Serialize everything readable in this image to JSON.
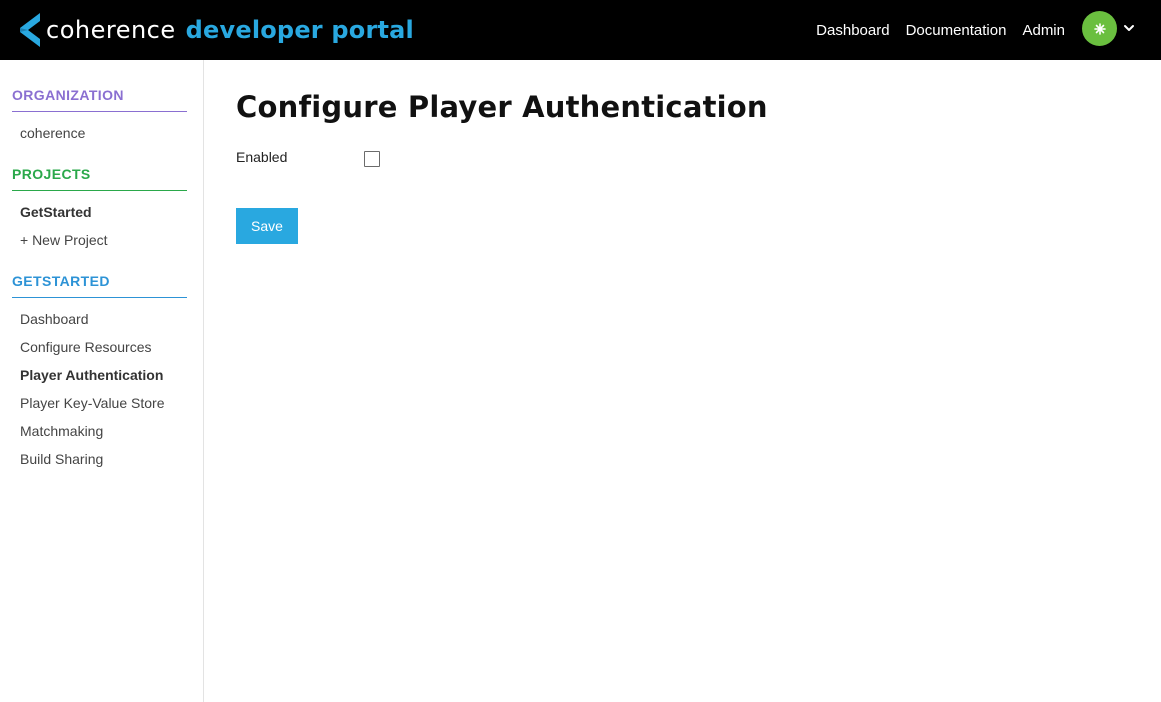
{
  "header": {
    "brand_name": "coherence",
    "brand_sub": "developer portal",
    "nav": [
      {
        "label": "Dashboard"
      },
      {
        "label": "Documentation"
      },
      {
        "label": "Admin"
      }
    ],
    "avatar_color": "#6abf3f",
    "accent": "#29a8e0"
  },
  "sidebar": {
    "organization": {
      "heading": "ORGANIZATION",
      "color": "#8a6fd1",
      "items": [
        {
          "label": "coherence"
        }
      ]
    },
    "projects": {
      "heading": "PROJECTS",
      "color": "#2aa84a",
      "items": [
        {
          "label": "GetStarted",
          "active": true
        },
        {
          "label": "+ New Project"
        }
      ]
    },
    "project_nav": {
      "heading": "GETSTARTED",
      "color": "#2d93d6",
      "items": [
        {
          "label": "Dashboard"
        },
        {
          "label": "Configure Resources"
        },
        {
          "label": "Player Authentication",
          "active": true
        },
        {
          "label": "Player Key-Value Store"
        },
        {
          "label": "Matchmaking"
        },
        {
          "label": "Build Sharing"
        }
      ]
    }
  },
  "main": {
    "title": "Configure Player Authentication",
    "enabled_label": "Enabled",
    "enabled_checked": false,
    "save_label": "Save"
  }
}
